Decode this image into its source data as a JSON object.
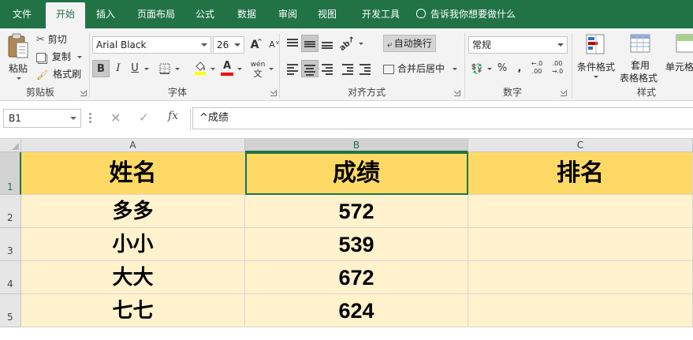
{
  "tabs": [
    "文件",
    "开始",
    "插入",
    "页面布局",
    "公式",
    "数据",
    "审阅",
    "视图",
    "开发工具"
  ],
  "active_tab": "开始",
  "tell_me": "告诉我你想要做什么",
  "clipboard": {
    "paste": "粘贴",
    "cut": "剪切",
    "copy": "复制",
    "format_painter": "格式刷",
    "group": "剪贴板"
  },
  "font": {
    "name": "Arial Black",
    "size": "26",
    "bold": "B",
    "italic": "I",
    "underline": "U",
    "grow": "A",
    "shrink": "A",
    "font_color_letter": "A",
    "wen": "wén",
    "group": "字体",
    "fill_color": "#ffff00",
    "font_color": "#ff0000"
  },
  "alignment": {
    "wrap": "自动换行",
    "merge": "合并后居中",
    "group": "对齐方式"
  },
  "number": {
    "format": "常规",
    "percent": "%",
    "comma": ",",
    "group": "数字"
  },
  "styles": {
    "conditional": "条件格式",
    "table_line1": "套用",
    "table_line2": "表格格式",
    "cell_styles": "单元格",
    "group": "样式"
  },
  "formula_bar": {
    "name_box": "B1",
    "fx": "fx",
    "content": "^成绩"
  },
  "columns": [
    "A",
    "B",
    "C"
  ],
  "rows": [
    "1",
    "2",
    "3",
    "4",
    "5"
  ],
  "table": {
    "header": [
      "姓名",
      "成绩",
      "排名"
    ],
    "data": [
      [
        "多多",
        "572",
        ""
      ],
      [
        "小小",
        "539",
        ""
      ],
      [
        "大大",
        "672",
        ""
      ],
      [
        "七七",
        "624",
        ""
      ]
    ]
  },
  "colors": {
    "accent": "#217346",
    "header_fill": "#ffd966",
    "body_fill": "#fff2cc"
  }
}
